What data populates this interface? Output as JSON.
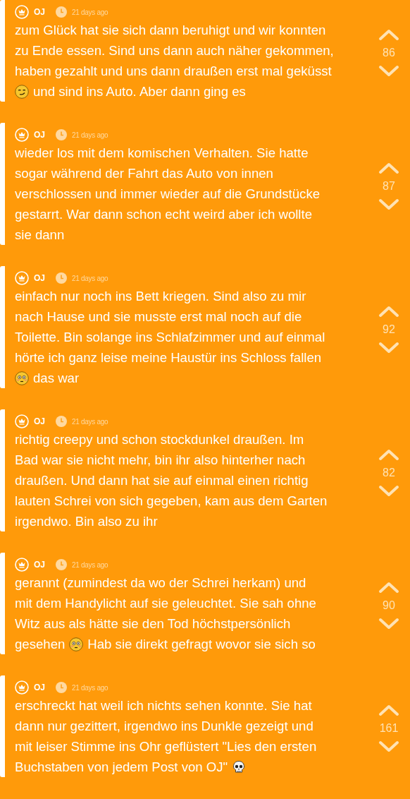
{
  "posts": [
    {
      "author": "OJ",
      "time": "21 days ago",
      "votes": "86",
      "lines": [
        [
          {
            "kind": "text",
            "text": "zum Glück hat sie sich dann beruhigt und wir konnten"
          }
        ],
        [
          {
            "kind": "text",
            "text": "zu Ende essen. Sind uns dann auch näher gekommen,"
          }
        ],
        [
          {
            "kind": "text",
            "text": "haben gezahlt und uns dann draußen erst mal geküsst"
          }
        ],
        [
          {
            "kind": "smirk"
          },
          {
            "kind": "text",
            "text": "und sind ins Auto. Aber dann ging es"
          }
        ]
      ]
    },
    {
      "author": "OJ",
      "time": "21 days ago",
      "votes": "87",
      "lines": [
        [
          {
            "kind": "text",
            "text": "wieder los mit dem komischen Verhalten. Sie hatte"
          }
        ],
        [
          {
            "kind": "text",
            "text": "sogar während der Fahrt das Auto von innen"
          }
        ],
        [
          {
            "kind": "text",
            "text": "verschlossen und immer wieder auf die Grundstücke"
          }
        ],
        [
          {
            "kind": "text",
            "text": "gestarrt. War dann schon echt weird aber ich wollte"
          }
        ],
        [
          {
            "kind": "text",
            "text": "sie dann"
          }
        ]
      ]
    },
    {
      "author": "OJ",
      "time": "21 days ago",
      "votes": "92",
      "lines": [
        [
          {
            "kind": "text",
            "text": "einfach nur noch ins Bett kriegen. Sind also zu mir"
          }
        ],
        [
          {
            "kind": "text",
            "text": "nach Hause und sie musste erst mal noch auf die"
          }
        ],
        [
          {
            "kind": "text",
            "text": "Toilette. Bin solange ins Schlafzimmer und auf einmal"
          }
        ],
        [
          {
            "kind": "text",
            "text": "hörte ich ganz leise meine Haustür ins Schloss fallen"
          }
        ],
        [
          {
            "kind": "flushed"
          },
          {
            "kind": "text",
            "text": "das war"
          }
        ]
      ]
    },
    {
      "author": "OJ",
      "time": "21 days ago",
      "votes": "82",
      "lines": [
        [
          {
            "kind": "text",
            "text": "richtig creepy und schon stockdunkel draußen. Im"
          }
        ],
        [
          {
            "kind": "text",
            "text": "Bad war sie nicht mehr, bin ihr also hinterher nach"
          }
        ],
        [
          {
            "kind": "text",
            "text": "draußen. Und dann hat sie auf einmal einen richtig"
          }
        ],
        [
          {
            "kind": "text",
            "text": "lauten Schrei von sich gegeben, kam aus dem Garten"
          }
        ],
        [
          {
            "kind": "text",
            "text": "irgendwo. Bin also zu ihr"
          }
        ]
      ]
    },
    {
      "author": "OJ",
      "time": "21 days ago",
      "votes": "90",
      "lines": [
        [
          {
            "kind": "text",
            "text": "gerannt (zumindest da wo der Schrei herkam) und"
          }
        ],
        [
          {
            "kind": "text",
            "text": "mit dem Handylicht auf sie geleuchtet. Sie sah ohne"
          }
        ],
        [
          {
            "kind": "text",
            "text": "Witz aus als hätte sie den Tod höchstpersönlich"
          }
        ],
        [
          {
            "kind": "text",
            "text": "gesehen"
          },
          {
            "kind": "flushed"
          },
          {
            "kind": "text",
            "text": "Hab sie direkt gefragt wovor sie sich so"
          }
        ]
      ]
    },
    {
      "author": "OJ",
      "time": "21 days ago",
      "votes": "161",
      "lines": [
        [
          {
            "kind": "text",
            "text": "erschreckt hat weil ich nichts sehen konnte. Sie hat"
          }
        ],
        [
          {
            "kind": "text",
            "text": "dann nur gezittert, irgendwo ins Dunkle gezeigt und"
          }
        ],
        [
          {
            "kind": "text",
            "text": "mit leiser Stimme ins Ohr geflüstert \"Lies den ersten"
          }
        ],
        [
          {
            "kind": "text",
            "text": "Buchstaben von jedem Post von OJ\""
          },
          {
            "kind": "skull"
          }
        ]
      ]
    }
  ]
}
